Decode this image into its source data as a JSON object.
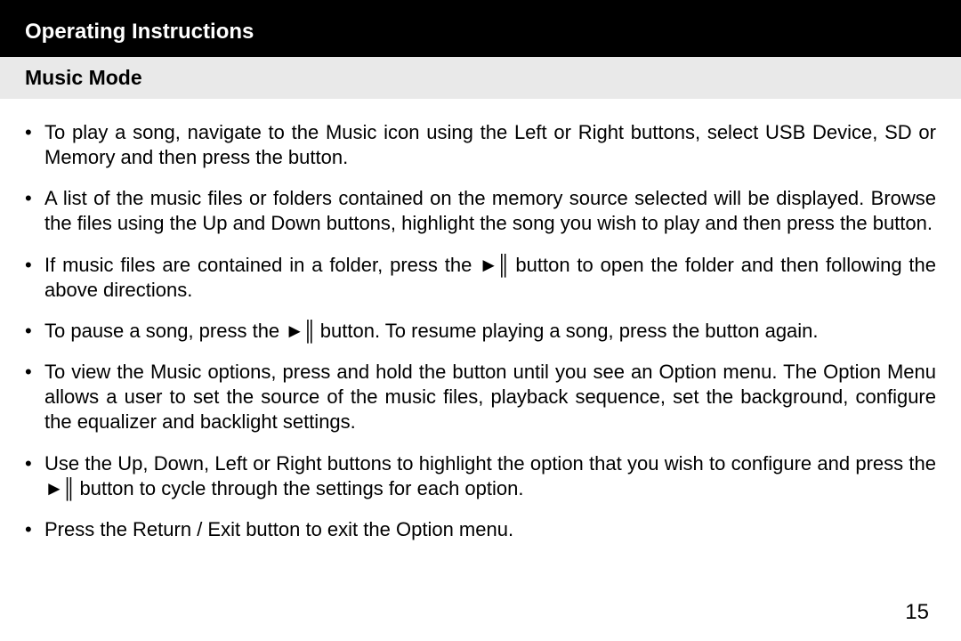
{
  "header": {
    "title": "Operating Instructions"
  },
  "section": {
    "title": "Music Mode"
  },
  "icons": {
    "playpause": "►║"
  },
  "bullets": [
    {
      "pre": "To play a song, navigate to the Music icon using the Left or Right buttons, select USB Device, SD or Memory and then press the  button."
    },
    {
      "pre": "A list of the music files or folders contained on the memory source selected will be displayed. Browse the files using the Up and Down buttons, highlight the song you wish to play and then press the  button."
    },
    {
      "pre": "If music files are contained in a folder, press the  ",
      "icon": "playpause",
      "post": "  button to open the folder and then following the above directions."
    },
    {
      "pre": "To pause a song, press the  ",
      "icon": "playpause",
      "post": "  button. To resume playing a song, press the  button again."
    },
    {
      "pre": "To view the Music options, press and hold the  button until you see an Option menu. The Option Menu allows a user to set the source of the music files, playback sequence, set the background, configure the equalizer and backlight settings."
    },
    {
      "pre": "Use the Up, Down, Left or Right buttons to highlight the option that you wish to configure and press the  ",
      "icon": "playpause",
      "post": "  button to cycle through the settings for each option."
    },
    {
      "pre": "Press the Return / Exit button to exit the Option menu."
    }
  ],
  "page_number": "15"
}
